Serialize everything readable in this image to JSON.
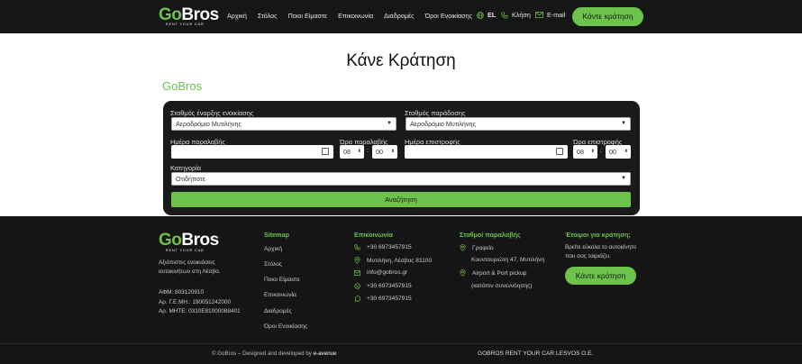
{
  "header": {
    "logo": {
      "text_pre": "Go",
      "text_post": "Bros",
      "tagline": "RENT YOUR CAR"
    },
    "nav": [
      "Αρχική",
      "Στόλος",
      "Ποιοι Είμαστε",
      "Επικοινωνία",
      "Διαδρομές",
      "Όροι Ενοικίασης"
    ],
    "language": "EL",
    "call_label": "Κλήση",
    "email_label": "E-mail",
    "cta_label": "Κάντε κράτηση"
  },
  "main": {
    "title": "Κάνε Κράτηση",
    "brand": "GoBros"
  },
  "form": {
    "pickup_station_label": "Σταθμός έναρξης ενοικίασης",
    "pickup_station_value": "Αεροδρόμιο Μυτιλήνης",
    "dropoff_station_label": "Σταθμός παράδοσης",
    "dropoff_station_value": "Αεροδρόμιο Μυτιλήνης",
    "pickup_date_label": "Ημέρα παραλαβής",
    "pickup_time_label": "Ώρα παραλαβής",
    "pickup_hour": "08",
    "pickup_minute": "00",
    "return_date_label": "Ημέρα επιστροφής",
    "return_time_label": "Ώρα επιστροφής",
    "return_hour": "08",
    "return_minute": "00",
    "category_label": "Κατηγορία",
    "category_value": "Οτιδήποτε",
    "search_label": "Αναζήτηση"
  },
  "footer": {
    "description": [
      "Αξιόπιστες ενοικιάσεις",
      "αυτοκινήτων στη Λέσβο."
    ],
    "afm": "ΑΦΜ: 803120910",
    "gemi": "Αρ. Γ.Ε.ΜΗ.: 190051242000",
    "mhte": "Αρ. ΜΗΤΕ: 0310Ε81000088401",
    "sitemap_title": "Sitemap",
    "sitemap_links": [
      "Αρχική",
      "Στόλος",
      "Ποιοι Είμαστε",
      "Επικοινωνία",
      "Διαδρομές",
      "Όροι Ενοικίασης"
    ],
    "contact_title": "Επικοινωνία",
    "contact_items": [
      {
        "icon": "phone-icon",
        "text": "+30 6973457915"
      },
      {
        "icon": "location-icon",
        "text": "Μυτιλήνη, Λέσβος 81100"
      },
      {
        "icon": "mail-icon",
        "text": "info@gobros.gr"
      },
      {
        "icon": "viber-icon",
        "text": "+30 6973457915"
      },
      {
        "icon": "whatsapp-icon",
        "text": "+30 6973457915"
      }
    ],
    "stations_title": "Σταθμοί παραλαβής",
    "station_1_title": "Γραφείο",
    "station_1_address": "Κουντουριώτη 47, Μυτιλήνη",
    "station_2_title": "Airport & Port pickup",
    "station_2_note": "(κατόπιν συνεννόησης)",
    "ready_title": "Έτοιμοι για κράτηση;",
    "ready_text": [
      "Βρείτε εύκολα το αυτοκίνητο",
      "που σας ταιριάζει."
    ],
    "cta_label": "Κάντε κράτηση",
    "copyright_prefix": "© GoBros – Designed and developed by",
    "developer": "e-avenue",
    "company": "GOBROS RENT YOUR CAR LESVOS O.E."
  },
  "colors": {
    "accent": "#6cc24a",
    "dark": "#161616"
  }
}
